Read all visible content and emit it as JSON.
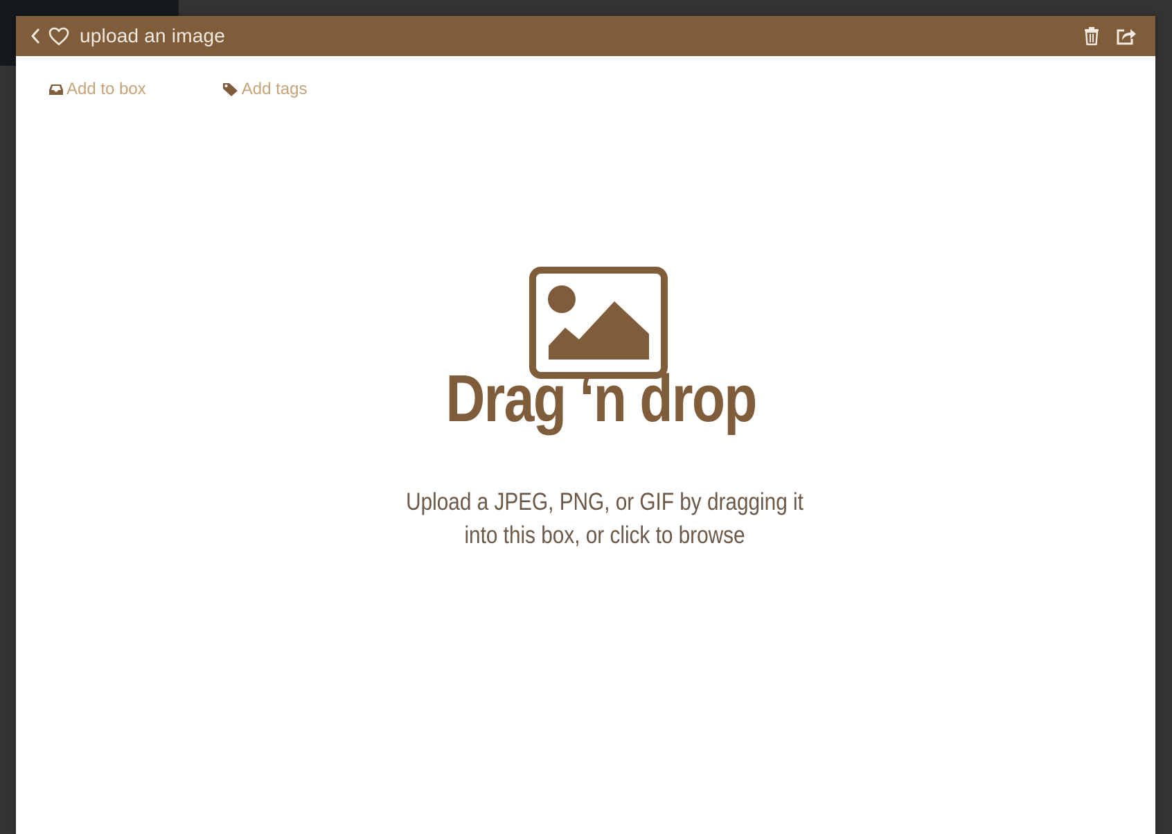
{
  "window": {
    "title": "upload an image"
  },
  "toolbar": {
    "add_to_box_label": "Add to box",
    "add_tags_label": "Add tags"
  },
  "dropzone": {
    "title": "Drag ‘n drop",
    "description_line1": "Upload a JPEG, PNG, or GIF by dragging it",
    "description_line2": "into this box, or click to browse"
  },
  "icons": {
    "back": "chevron-left-icon",
    "favorite": "heart-outline-icon",
    "delete": "trash-icon",
    "share": "share-icon",
    "box": "inbox-icon",
    "tags": "tag-icon",
    "image": "image-placeholder-icon"
  },
  "colors": {
    "brand": "#7f5c3a",
    "link": "#c6a378",
    "title_text": "#f3ebe1",
    "body_text": "#6b5848"
  }
}
